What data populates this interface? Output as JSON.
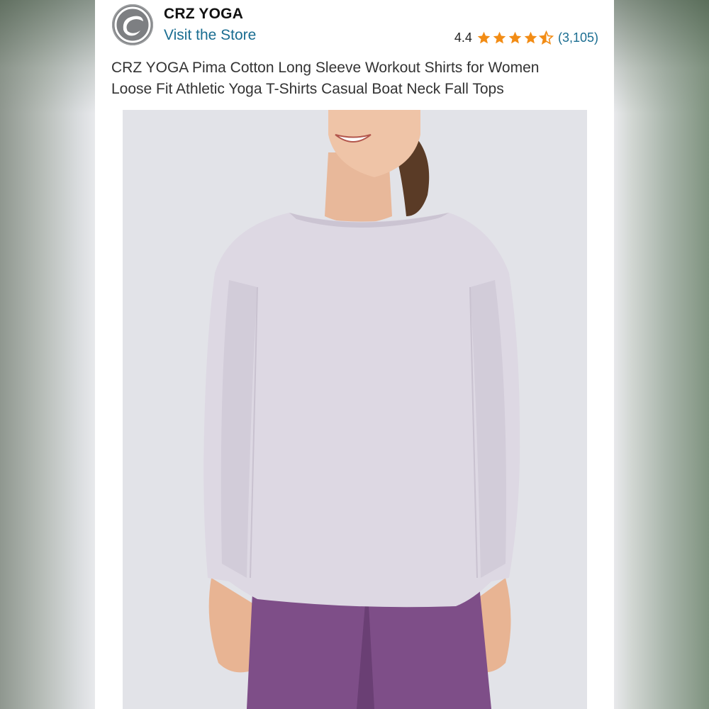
{
  "store": {
    "brand_name": "CRZ YOGA",
    "visit_link": "Visit the Store",
    "logo_icon": "crz-yoga-logo"
  },
  "rating": {
    "value": "4.4",
    "stars_out_of_5": 4.4,
    "review_count": "(3,105)",
    "star_color": "#f28c15",
    "link_color": "#1a6d91"
  },
  "product": {
    "title_lines": [
      "CRZ YOGA Pima Cotton Long Sleeve Workout Shirts for Women",
      "Loose Fit Athletic Yoga T-Shirts Casual Boat Neck Fall Tops"
    ],
    "image_subject": "model-wearing-lavender-long-sleeve-top",
    "shirt_color": "#ddd8e3",
    "leggings_color": "#7e4e88"
  }
}
